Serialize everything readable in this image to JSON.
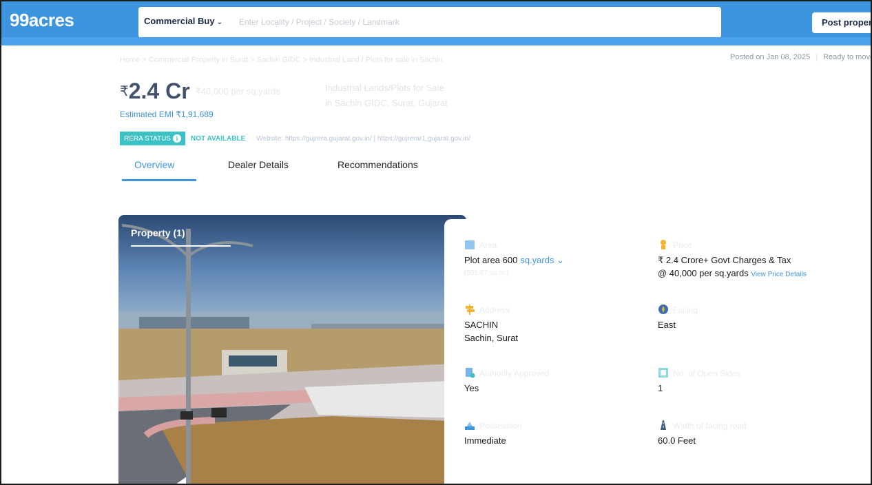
{
  "header": {
    "logo": "99acres",
    "search_type": "Commercial Buy",
    "search_placeholder": "Enter Locality / Project / Society / Landmark",
    "post_button": "Post property"
  },
  "breadcrumb": "Home > Commercial Property in Surat > Sachin GIDC > Industrial Land / Plots for sale in Sachin",
  "posted": {
    "date": "Posted on Jan 08, 2025",
    "status": "Ready to move"
  },
  "price": {
    "symbol": "₹",
    "amount": "2.4 Cr",
    "per_unit": "₹40,000 per sq.yards",
    "emi": "Estimated EMI ₹1,91,689"
  },
  "title": {
    "line1": "Industrial Lands/Plots for Sale",
    "line2": "in Sachin GIDC, Surat, Gujarat"
  },
  "rera": {
    "badge": "RERA STATUS",
    "status": "NOT AVAILABLE",
    "website": "Website: https://gujrera.gujarat.gov.in/ | https://gujrerar1.gujarat.gov.in/"
  },
  "tabs": [
    {
      "label": "Overview"
    },
    {
      "label": "Dealer Details"
    },
    {
      "label": "Recommendations"
    }
  ],
  "property_label": "Property (1)",
  "details": {
    "area": {
      "label": "Area",
      "value": "Plot area 600",
      "unit": "sq.yards",
      "sub": "(501.67 sq.m.)"
    },
    "price": {
      "label": "Price",
      "value": "₹ 2.4 Crore+ Govt Charges & Tax",
      "per": "@ 40,000 per sq.yards",
      "link": "View Price Details"
    },
    "address": {
      "label": "Address",
      "line1": "SACHIN",
      "line2": "Sachin, Surat"
    },
    "facing": {
      "label": "Facing",
      "value": "East"
    },
    "authority": {
      "label": "Authority Approved",
      "value": "Yes"
    },
    "open_sides": {
      "label": "No. of Open Sides",
      "value": "1"
    },
    "possession": {
      "label": "Possession",
      "value": "Immediate"
    },
    "road_width": {
      "label": "Width of facing road",
      "value": "60.0 Feet"
    }
  },
  "colors": {
    "brand_blue": "#3d95e0",
    "rera_teal": "#3cc2c6",
    "price_text": "#42526e"
  }
}
